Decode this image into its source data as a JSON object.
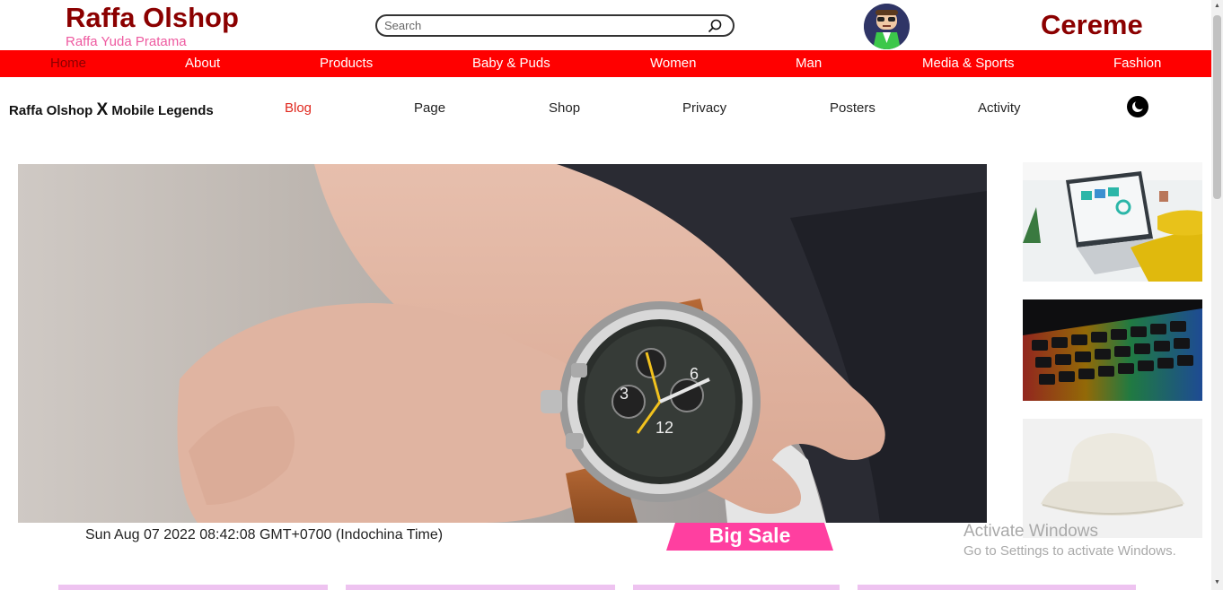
{
  "header": {
    "brand_title": "Raffa Olshop",
    "brand_subtitle": "Raffa Yuda Pratama",
    "search_placeholder": "Search",
    "right_title": "Cereme"
  },
  "main_nav": {
    "items": [
      "Home",
      "About",
      "Products",
      "Baby & Puds",
      "Women",
      "Man",
      "Media & Sports",
      "Fashion"
    ],
    "active": "Home"
  },
  "sub_nav": {
    "brand_left": "Raffa Olshop",
    "brand_x": "X",
    "brand_right": "Mobile Legends",
    "links": [
      "Blog",
      "Page",
      "Shop",
      "Privacy",
      "Posters",
      "Activity"
    ],
    "active": "Blog"
  },
  "content": {
    "date_text": "Sun Aug 07 2022 08:42:08 GMT+0700 (Indochina Time)",
    "sale_label": "Big Sale"
  },
  "watermark": {
    "line1": "Activate Windows",
    "line2": "Go to Settings to activate Windows."
  },
  "colors": {
    "brand": "#8b0000",
    "nav_bg": "#ff0000",
    "subtitle": "#ee5aa0",
    "sale_bg": "#ff3fa0",
    "active_link": "#e0281e",
    "card_strip": "#eec3f0"
  },
  "icons": [
    "search-icon",
    "moon-icon",
    "avatar"
  ]
}
